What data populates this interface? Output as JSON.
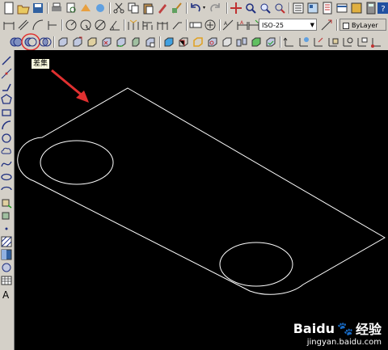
{
  "tooltip": {
    "text": "差集"
  },
  "combos": {
    "dimstyle": "ISO-25",
    "layer": "ByLayer"
  },
  "watermark": {
    "brand_cn": "经验",
    "brand_en": "Baidu",
    "url": "jingyan.baidu.com"
  },
  "left_toolbar": {
    "text_label": "A",
    "icons": [
      "line-icon",
      "construction-line-icon",
      "polyline-icon",
      "polygon-icon",
      "rectangle-icon",
      "arc-icon",
      "circle-icon",
      "revision-cloud-icon",
      "spline-icon",
      "ellipse-icon",
      "ellipse-arc-icon",
      "insert-block-icon",
      "make-block-icon",
      "point-icon",
      "hatch-icon",
      "gradient-icon",
      "region-icon",
      "table-icon",
      "multiline-text-icon"
    ]
  },
  "colors": {
    "canvas": "#000000",
    "drawing": "#ffffff",
    "arrow": "#e03030",
    "highlight": "#e03030",
    "toolbar": "#d4d0c8"
  }
}
